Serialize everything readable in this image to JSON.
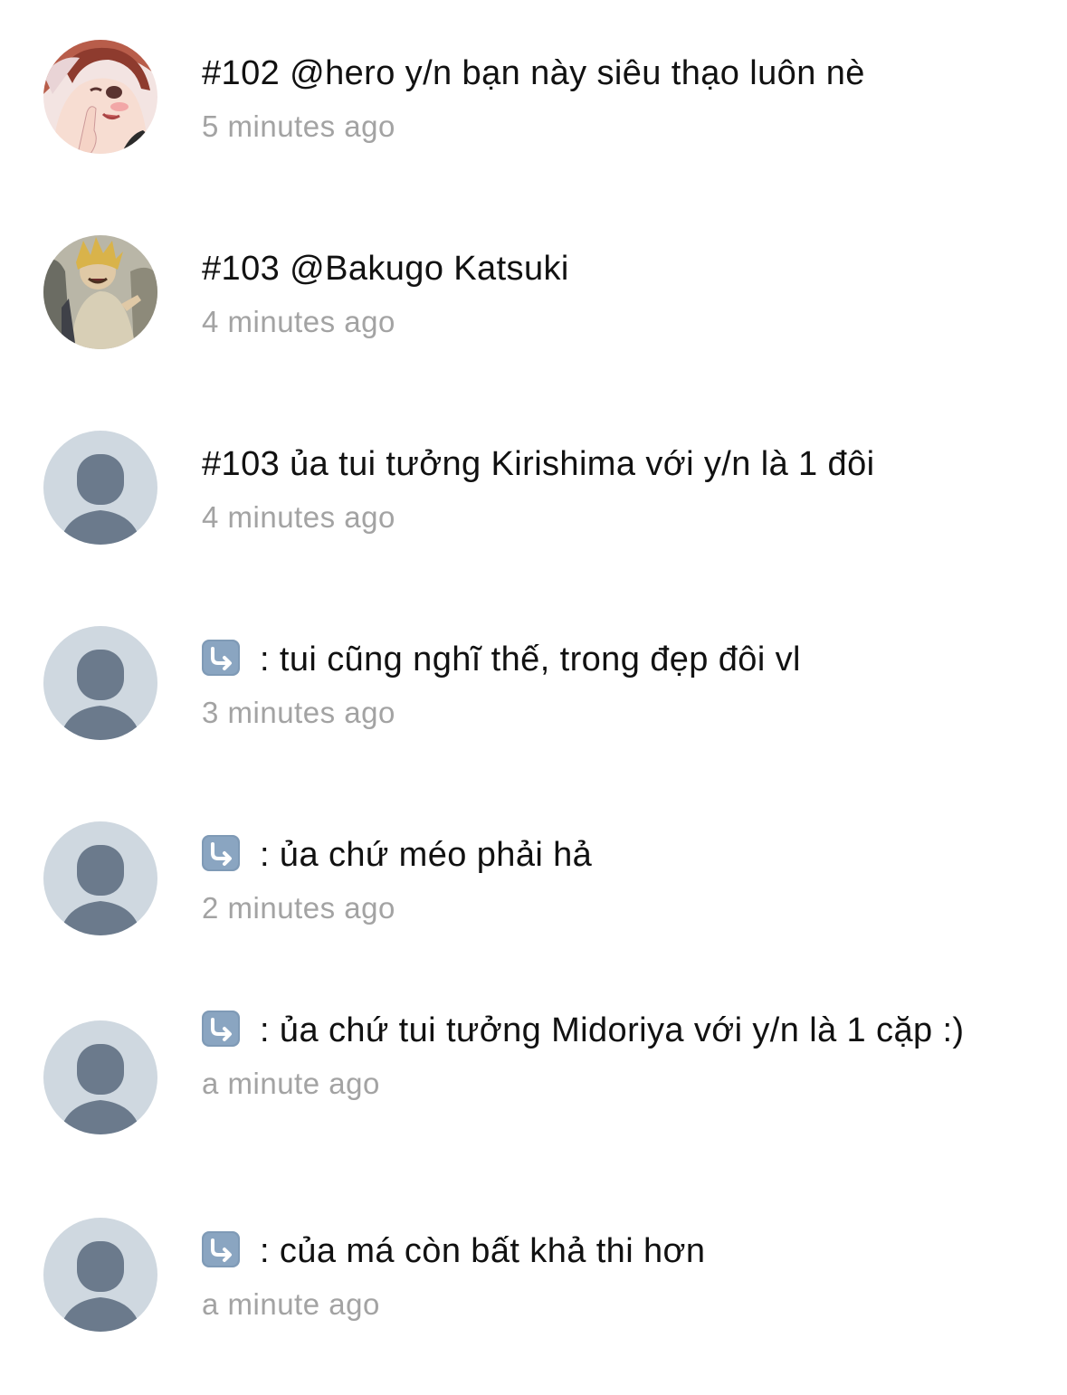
{
  "feed": {
    "items": [
      {
        "avatar": "anime-girl-avatar",
        "has_reply_icon": false,
        "text": "#102 @hero y/n bạn này siêu thạo luôn nè",
        "time": "5 minutes ago"
      },
      {
        "avatar": "anime-boy-avatar",
        "has_reply_icon": false,
        "text": "#103 @Bakugo Katsuki",
        "time": "4 minutes ago"
      },
      {
        "avatar": "default-user-avatar",
        "has_reply_icon": false,
        "text": "#103 ủa tui tưởng Kirishima với y/n là 1 đôi",
        "time": "4 minutes ago"
      },
      {
        "avatar": "default-user-avatar",
        "has_reply_icon": true,
        "reply_icon": "reply-arrow-icon",
        "text": ": tui cũng nghĩ thế, trong đẹp đôi vl",
        "time": "3 minutes ago"
      },
      {
        "avatar": "default-user-avatar",
        "has_reply_icon": true,
        "reply_icon": "reply-arrow-icon",
        "text": ": ủa chứ méo phải hả",
        "time": "2 minutes ago"
      },
      {
        "avatar": "default-user-avatar",
        "has_reply_icon": true,
        "reply_icon": "reply-arrow-icon",
        "text": ": ủa chứ tui tưởng Midoriya với y/n là 1 cặp :)",
        "time": "a minute ago"
      },
      {
        "avatar": "default-user-avatar",
        "has_reply_icon": true,
        "reply_icon": "reply-arrow-icon",
        "text": ": của má còn bất khả thi hơn",
        "time": "a minute ago"
      }
    ]
  },
  "colors": {
    "text": "#111111",
    "timestamp": "#a3a3a3",
    "default_avatar_bg": "#cfd8e0",
    "default_avatar_figure": "#6b7a8c",
    "reply_icon_bg": "#7f9ab6"
  }
}
